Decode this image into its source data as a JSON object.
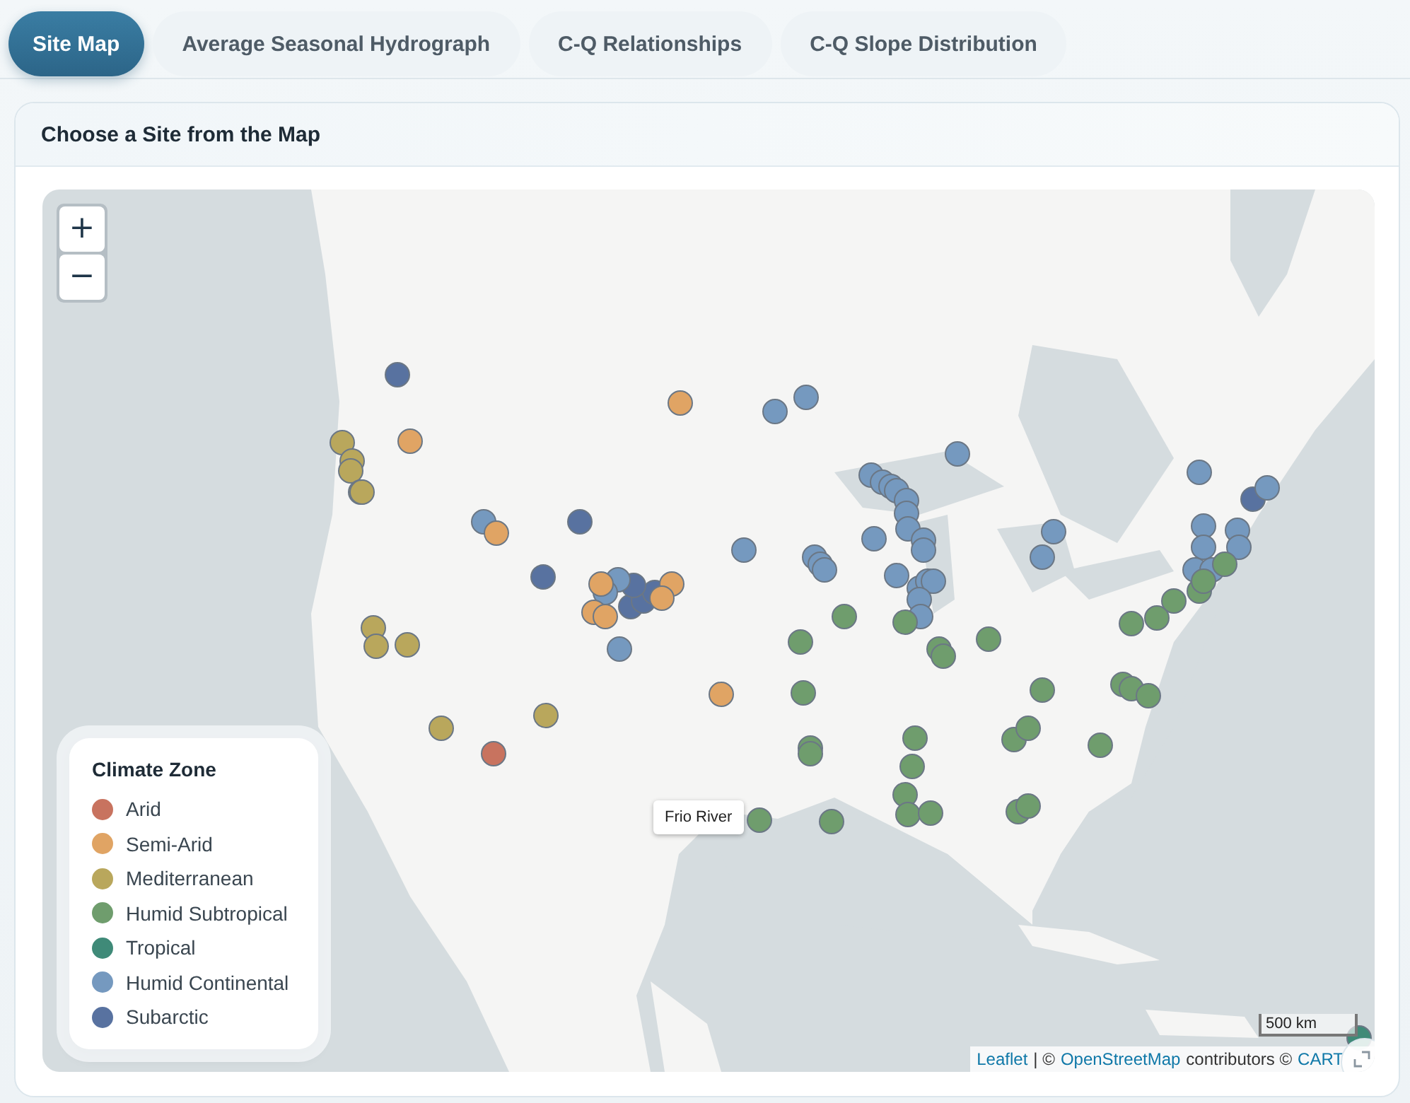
{
  "tabs": [
    {
      "label": "Site Map",
      "selected": true
    },
    {
      "label": "Average Seasonal Hydrograph",
      "selected": false
    },
    {
      "label": "C-Q Relationships",
      "selected": false
    },
    {
      "label": "C-Q Slope Distribution",
      "selected": false
    }
  ],
  "panel": {
    "title": "Choose a Site from the Map"
  },
  "map": {
    "kind": "picture",
    "zoom_in": "+",
    "zoom_out": "−",
    "tooltip": "Frio River",
    "scale": "500 km",
    "attribution": {
      "leaflet": "Leaflet",
      "separator": "| ©",
      "osm": "OpenStreetMap",
      "contributors": "contributors ©",
      "carto": "CART"
    },
    "legend": {
      "title": "Climate Zone",
      "items": [
        {
          "label": "Arid",
          "color": "#c8735f"
        },
        {
          "label": "Semi-Arid",
          "color": "#e0a464"
        },
        {
          "label": "Mediterranean",
          "color": "#b9a75c"
        },
        {
          "label": "Humid Subtropical",
          "color": "#6f9d6d"
        },
        {
          "label": "Tropical",
          "color": "#3f8a78"
        },
        {
          "label": "Humid Continental",
          "color": "#7599bf"
        },
        {
          "label": "Subarctic",
          "color": "#5872a0"
        }
      ]
    },
    "markers": [
      {
        "color": "#5872a0"
      },
      {
        "color": "#5872a0"
      },
      {
        "color": "#5872a0"
      },
      {
        "color": "#5872a0"
      },
      {
        "color": "#5872a0"
      },
      {
        "color": "#5872a0"
      },
      {
        "color": "#5872a0"
      },
      {
        "color": "#5872a0"
      },
      {
        "color": "#7599bf"
      },
      {
        "color": "#7599bf"
      },
      {
        "color": "#7599bf"
      },
      {
        "color": "#7599bf"
      },
      {
        "color": "#7599bf"
      },
      {
        "color": "#7599bf"
      },
      {
        "color": "#7599bf"
      },
      {
        "color": "#7599bf"
      },
      {
        "color": "#7599bf"
      },
      {
        "color": "#7599bf"
      },
      {
        "color": "#7599bf"
      },
      {
        "color": "#7599bf"
      },
      {
        "color": "#7599bf"
      },
      {
        "color": "#7599bf"
      },
      {
        "color": "#7599bf"
      },
      {
        "color": "#7599bf"
      },
      {
        "color": "#7599bf"
      },
      {
        "color": "#7599bf"
      },
      {
        "color": "#7599bf"
      },
      {
        "color": "#7599bf"
      },
      {
        "color": "#7599bf"
      },
      {
        "color": "#7599bf"
      },
      {
        "color": "#7599bf"
      },
      {
        "color": "#7599bf"
      },
      {
        "color": "#7599bf"
      },
      {
        "color": "#7599bf"
      },
      {
        "color": "#7599bf"
      },
      {
        "color": "#7599bf"
      },
      {
        "color": "#7599bf"
      },
      {
        "color": "#7599bf"
      },
      {
        "color": "#7599bf"
      },
      {
        "color": "#7599bf"
      },
      {
        "color": "#7599bf"
      },
      {
        "color": "#7599bf"
      },
      {
        "color": "#7599bf"
      },
      {
        "color": "#7599bf"
      },
      {
        "color": "#7599bf"
      },
      {
        "color": "#e0a464"
      },
      {
        "color": "#e0a464"
      },
      {
        "color": "#e0a464"
      },
      {
        "color": "#e0a464"
      },
      {
        "color": "#e0a464"
      },
      {
        "color": "#e0a464"
      },
      {
        "color": "#e0a464"
      },
      {
        "color": "#e0a464"
      },
      {
        "color": "#e0a464"
      },
      {
        "color": "#b9a75c"
      },
      {
        "color": "#b9a75c"
      },
      {
        "color": "#b9a75c"
      },
      {
        "color": "#b9a75c"
      },
      {
        "color": "#b9a75c"
      },
      {
        "color": "#b9a75c"
      },
      {
        "color": "#b9a75c"
      },
      {
        "color": "#b9a75c"
      },
      {
        "color": "#b9a75c"
      },
      {
        "color": "#b9a75c"
      },
      {
        "color": "#c8735f"
      },
      {
        "color": "#6f9d6d"
      },
      {
        "color": "#6f9d6d"
      },
      {
        "color": "#6f9d6d"
      },
      {
        "color": "#6f9d6d"
      },
      {
        "color": "#6f9d6d"
      },
      {
        "color": "#6f9d6d"
      },
      {
        "color": "#6f9d6d"
      },
      {
        "color": "#6f9d6d"
      },
      {
        "color": "#6f9d6d"
      },
      {
        "color": "#6f9d6d"
      },
      {
        "color": "#6f9d6d"
      },
      {
        "color": "#6f9d6d"
      },
      {
        "color": "#6f9d6d"
      },
      {
        "color": "#6f9d6d"
      },
      {
        "color": "#6f9d6d"
      },
      {
        "color": "#6f9d6d"
      },
      {
        "color": "#6f9d6d"
      },
      {
        "color": "#6f9d6d"
      },
      {
        "color": "#6f9d6d"
      },
      {
        "color": "#6f9d6d"
      },
      {
        "color": "#6f9d6d"
      },
      {
        "color": "#6f9d6d"
      },
      {
        "color": "#6f9d6d"
      },
      {
        "color": "#6f9d6d"
      },
      {
        "color": "#6f9d6d"
      },
      {
        "color": "#6f9d6d"
      },
      {
        "color": "#6f9d6d"
      },
      {
        "color": "#6f9d6d"
      },
      {
        "color": "#6f9d6d"
      },
      {
        "color": "#6f9d6d"
      },
      {
        "color": "#6f9d6d"
      },
      {
        "color": "#3f8a78"
      }
    ]
  }
}
